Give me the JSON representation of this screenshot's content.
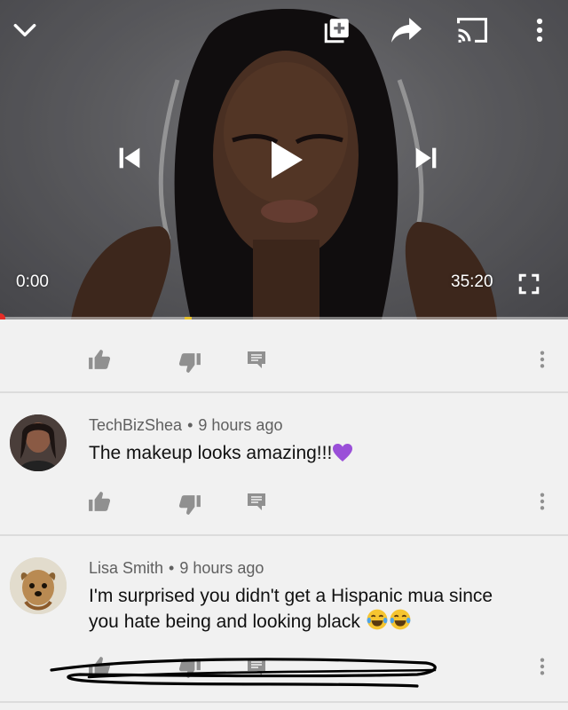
{
  "player": {
    "current_time": "0:00",
    "duration": "35:20",
    "progress_fraction": 0.0
  },
  "comments": [
    {
      "author": "TechBizShea",
      "age": "9 hours ago",
      "text": "The makeup looks amazing!!!",
      "emoji": "purple-heart"
    },
    {
      "author": "Lisa Smith",
      "age": "9 hours ago",
      "text_line1": "I'm surprised you didn't get a Hispanic mua since",
      "text_line2": "you hate being and looking black",
      "emoji": "tears-of-joy x2"
    }
  ],
  "colors": {
    "icon_gray": "#909090",
    "progress_red": "#e52d27",
    "background": "#f1f1f1"
  }
}
